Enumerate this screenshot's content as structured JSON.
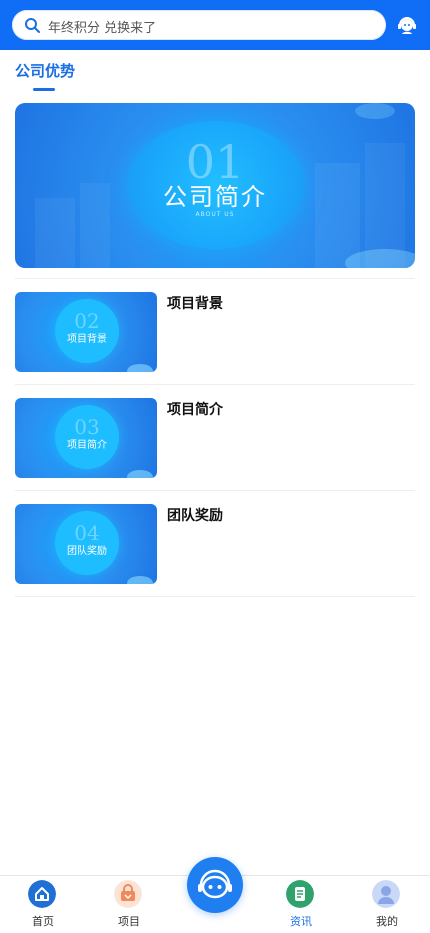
{
  "search": {
    "placeholder": "年终积分 兑换来了"
  },
  "section": {
    "title": "公司优势"
  },
  "hero": {
    "number": "01",
    "label": "公司简介",
    "sub": "ABOUT US"
  },
  "items": [
    {
      "number": "02",
      "thumb_label": "项目背景",
      "title": "项目背景"
    },
    {
      "number": "03",
      "thumb_label": "项目简介",
      "title": "项目简介"
    },
    {
      "number": "04",
      "thumb_label": "团队奖励",
      "title": "团队奖励"
    }
  ],
  "tabs": [
    {
      "label": "首页",
      "icon": "home-icon",
      "color": "#1f6fd6"
    },
    {
      "label": "项目",
      "icon": "basket-icon",
      "color": "#f08a5a"
    },
    {
      "label": "资讯",
      "icon": "news-icon",
      "color": "#2fa36b"
    },
    {
      "label": "我的",
      "icon": "user-icon",
      "color": "#8aa6e8"
    }
  ],
  "colors": {
    "primary": "#0f6ef5",
    "accent_text": "#1b6fe3"
  }
}
